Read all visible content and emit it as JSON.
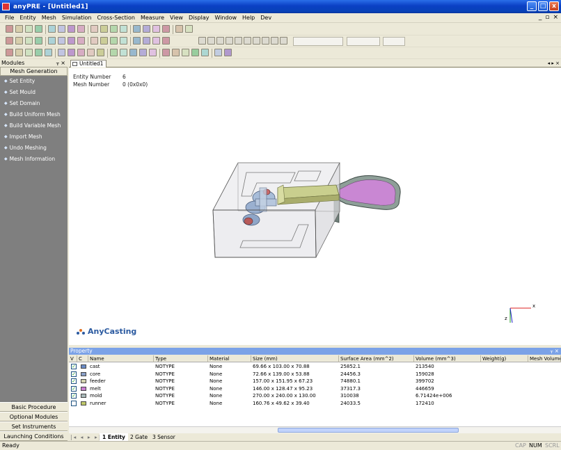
{
  "window": {
    "title": "anyPRE - [Untitled1]",
    "minimize": "_",
    "maximize": "□",
    "close": "x"
  },
  "menubar": {
    "items": [
      "File",
      "Entity",
      "Mesh",
      "Simulation",
      "Cross-Section",
      "Measure",
      "View",
      "Display",
      "Window",
      "Help",
      "Dev"
    ],
    "mdi_controls": [
      "_",
      "▫",
      "×"
    ]
  },
  "modules": {
    "header": "Modules",
    "pin": "ᚁ ×",
    "active_group": "Mesh Generation",
    "items": [
      "Set Entity",
      "Set Mould",
      "Set Domain",
      "Build Uniform Mesh",
      "Build Variable Mesh",
      "Import Mesh",
      "Undo Meshing",
      "Mesh Information"
    ],
    "footer_groups": [
      "Basic Procedure",
      "Optional Modules",
      "Set Instruments",
      "Launching Conditions"
    ]
  },
  "document": {
    "tab": "Untitled1",
    "nav": "◂ ▸ ×",
    "entity_label": "Entity Number",
    "entity_value": "6",
    "mesh_label": "Mesh Number",
    "mesh_value": "0 (0x0x0)",
    "logo": "AnyCasting",
    "axis_x": "x",
    "axis_z": "z"
  },
  "property": {
    "header": "Property",
    "controls": "ᚁ ×",
    "columns": [
      "V",
      "C",
      "Name",
      "Type",
      "Material",
      "Size (mm)",
      "Surface Area (mm^2)",
      "Volume (mm^3)",
      "Weight(g)",
      "Mesh Volume"
    ],
    "rows": [
      {
        "checked": true,
        "color": "#6b8cc7",
        "name": "cast",
        "type": "NOTYPE",
        "material": "None",
        "size": "69.66 x 103.00 x 70.88",
        "area": "25852.1",
        "volume": "213540",
        "weight": "",
        "mesh": ""
      },
      {
        "checked": true,
        "color": "#8aa0c8",
        "name": "core",
        "type": "NOTYPE",
        "material": "None",
        "size": "72.66 x 139.00 x 53.88",
        "area": "24456.3",
        "volume": "159028",
        "weight": "",
        "mesh": ""
      },
      {
        "checked": true,
        "color": "#d4d4b0",
        "name": "feeder",
        "type": "NOTYPE",
        "material": "None",
        "size": "157.00 x 151.95 x 67.23",
        "area": "74880.1",
        "volume": "399702",
        "weight": "",
        "mesh": ""
      },
      {
        "checked": true,
        "color": "#c87ed0",
        "name": "melt",
        "type": "NOTYPE",
        "material": "None",
        "size": "146.00 x 128.47 x 95.23",
        "area": "37317.3",
        "volume": "446659",
        "weight": "",
        "mesh": ""
      },
      {
        "checked": true,
        "color": "#a8b8b8",
        "name": "mold",
        "type": "NOTYPE",
        "material": "None",
        "size": "270.00 x 240.00 x 130.00",
        "area": "310038",
        "volume": "6.71424e+006",
        "weight": "",
        "mesh": ""
      },
      {
        "checked": false,
        "color": "#bfc86a",
        "name": "runner",
        "type": "NOTYPE",
        "material": "None",
        "size": "160.76 x 49.62 x 39.40",
        "area": "24033.5",
        "volume": "172410",
        "weight": "",
        "mesh": ""
      }
    ],
    "sheet_tabs": [
      "1 Entity",
      "2 Gate",
      "3 Sensor"
    ],
    "sheet_nav": "|◂ ◂ ▸ ▸|"
  },
  "status": {
    "text": "Ready",
    "indicators": [
      "CAP",
      "NUM",
      "SCRL"
    ]
  },
  "colors": {
    "titlebar": "#0a3fc4",
    "sidebar": "#7f7f7f",
    "melt": "#c87ed0",
    "runner": "#c9cf8e",
    "mold": "#e2e2e6"
  }
}
